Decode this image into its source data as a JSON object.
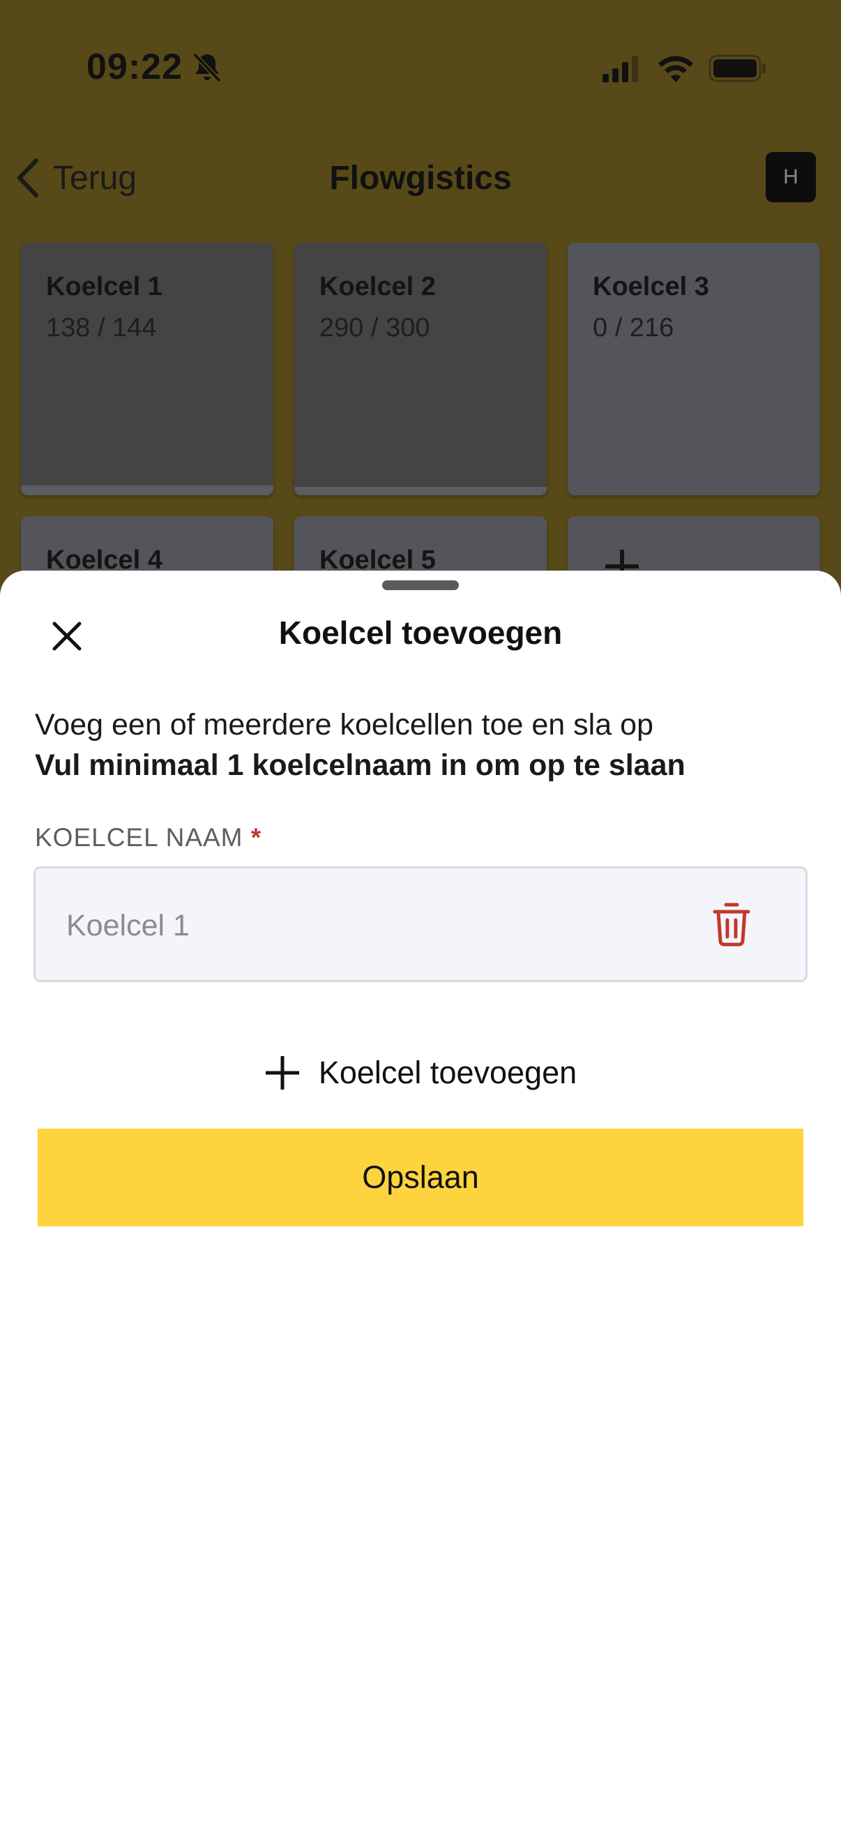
{
  "status_bar": {
    "time": "09:22",
    "icons": [
      "bell-slash-icon",
      "cellular-signal-icon",
      "wifi-icon",
      "battery-icon"
    ]
  },
  "nav": {
    "back_label": "Terug",
    "title": "Flowgistics",
    "avatar_letter": "H"
  },
  "cells": [
    {
      "name": "Koelcel 1",
      "count": "138 / 144",
      "fill": 0.958
    },
    {
      "name": "Koelcel 2",
      "count": "290 / 300",
      "fill": 0.967
    },
    {
      "name": "Koelcel 3",
      "count": "0 / 216",
      "fill": 0
    },
    {
      "name": "Koelcel 4"
    },
    {
      "name": "Koelcel 5"
    }
  ],
  "add_cell_tile_icon": "plus-icon",
  "sheet": {
    "title": "Koelcel toevoegen",
    "description": "Voeg een of meerdere koelcellen toe en sla op",
    "description_bold": "Vul minimaal 1 koelcelnaam in om op te slaan",
    "field_label": "KOELCEL NAAM",
    "required_marker": "*",
    "field_placeholder": "Koelcel 1",
    "field_value": "",
    "add_row_label": "Koelcel toevoegen",
    "save_label": "Opslaan"
  },
  "colors": {
    "accent": "#fed43e",
    "danger": "#c0392b",
    "backdrop": "#574a18"
  }
}
